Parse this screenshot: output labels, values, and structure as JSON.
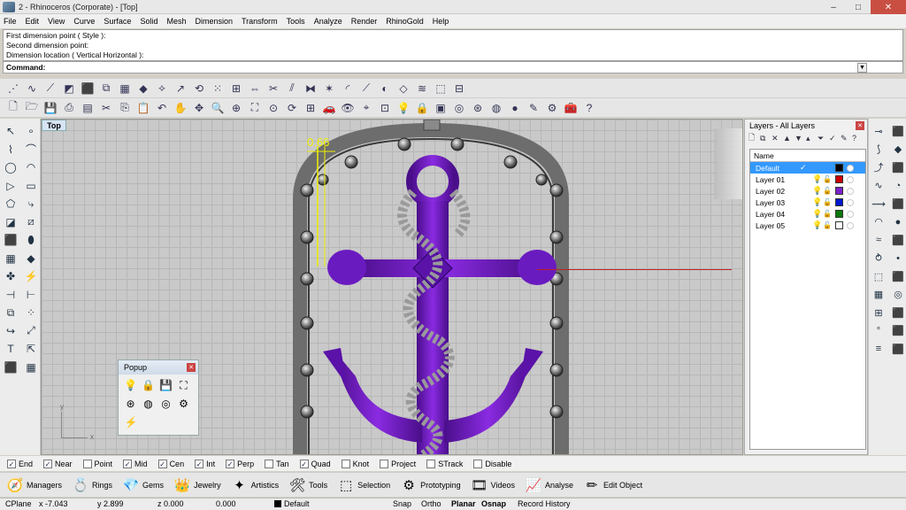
{
  "window": {
    "title": "2 - Rhinoceros (Corporate) - [Top]",
    "min": "–",
    "max": "□",
    "close": "✕"
  },
  "menu": [
    "File",
    "Edit",
    "View",
    "Curve",
    "Surface",
    "Solid",
    "Mesh",
    "Dimension",
    "Transform",
    "Tools",
    "Analyze",
    "Render",
    "RhinoGold",
    "Help"
  ],
  "command_history": [
    "First dimension point ( Style ):",
    "Second dimension point:",
    "Dimension location ( Vertical  Horizontal ):"
  ],
  "command": {
    "label": "Command:",
    "value": ""
  },
  "viewport": {
    "tab": "Top",
    "dimension_value": "0.66",
    "axis_x": "x",
    "axis_y": "y"
  },
  "popup": {
    "title": "Popup"
  },
  "layers": {
    "title": "Layers - All Layers",
    "column_name": "Name",
    "rows": [
      {
        "name": "Default",
        "color": "#000000",
        "selected": true
      },
      {
        "name": "Layer 01",
        "color": "#cc0000",
        "selected": false
      },
      {
        "name": "Layer 02",
        "color": "#7a22cc",
        "selected": false
      },
      {
        "name": "Layer 03",
        "color": "#0018cc",
        "selected": false
      },
      {
        "name": "Layer 04",
        "color": "#0a7a0a",
        "selected": false
      },
      {
        "name": "Layer 05",
        "color": "#ffffff",
        "selected": false
      }
    ]
  },
  "osnap": [
    {
      "label": "End",
      "checked": true
    },
    {
      "label": "Near",
      "checked": true
    },
    {
      "label": "Point",
      "checked": false
    },
    {
      "label": "Mid",
      "checked": true
    },
    {
      "label": "Cen",
      "checked": true
    },
    {
      "label": "Int",
      "checked": true
    },
    {
      "label": "Perp",
      "checked": true
    },
    {
      "label": "Tan",
      "checked": false
    },
    {
      "label": "Quad",
      "checked": true
    },
    {
      "label": "Knot",
      "checked": false
    },
    {
      "label": "Project",
      "checked": false
    },
    {
      "label": "STrack",
      "checked": false
    },
    {
      "label": "Disable",
      "checked": false
    }
  ],
  "tabs": [
    "Managers",
    "Rings",
    "Gems",
    "Jewelry",
    "Artistics",
    "Tools",
    "Selection",
    "Prototyping",
    "Videos",
    "Analyse",
    "Edit Object"
  ],
  "status": {
    "cplane": "CPlane",
    "x": "x -7.043",
    "y": "y 2.899",
    "z": "z 0.000",
    "extra": "0.000",
    "layer": "Default",
    "snap": "Snap",
    "ortho": "Ortho",
    "planar": "Planar",
    "osnap": "Osnap",
    "record": "Record History"
  },
  "colors": {
    "anchor": "#7b1fd6",
    "anchor_dark": "#4a0e8a",
    "frame": "#6d6d6d",
    "dimension": "#f0f000"
  }
}
